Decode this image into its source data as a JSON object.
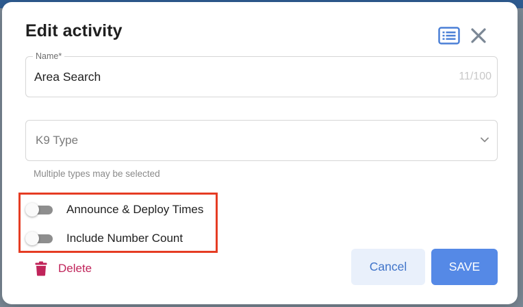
{
  "dialog": {
    "title": "Edit activity",
    "header_icons": [
      "list-icon",
      "close-icon"
    ]
  },
  "name_field": {
    "label": "Name*",
    "value": "Area Search",
    "counter": "11/100"
  },
  "k9_type_field": {
    "placeholder": "K9 Type",
    "helper": "Multiple types may be selected",
    "icon": "chevron-down-icon"
  },
  "toggles": [
    {
      "label": "Announce & Deploy Times",
      "checked": false
    },
    {
      "label": "Include Number Count",
      "checked": false
    }
  ],
  "actions": {
    "delete_label": "Delete",
    "delete_icon": "trash-icon",
    "cancel_label": "Cancel",
    "save_label": "SAVE"
  },
  "colors": {
    "primary": "#5589e6",
    "delete": "#c0245a",
    "highlight_border": "#e53c23",
    "cancel_bg": "#e9f0fb"
  }
}
